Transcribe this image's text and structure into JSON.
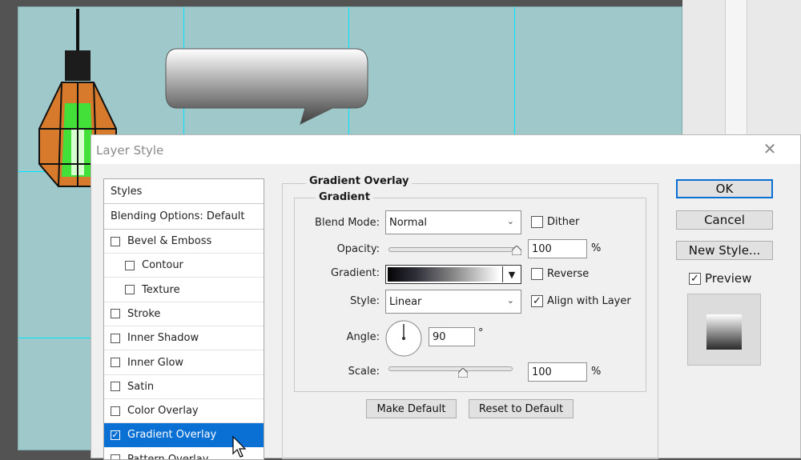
{
  "dialog": {
    "title": "Layer Style",
    "close_glyph": "✕"
  },
  "styles_list": {
    "header": "Styles",
    "blending": "Blending Options: Default",
    "items": [
      {
        "label": "Bevel & Emboss",
        "checked": false,
        "indent": false
      },
      {
        "label": "Contour",
        "checked": false,
        "indent": true
      },
      {
        "label": "Texture",
        "checked": false,
        "indent": true
      },
      {
        "label": "Stroke",
        "checked": false,
        "indent": false
      },
      {
        "label": "Inner Shadow",
        "checked": false,
        "indent": false
      },
      {
        "label": "Inner Glow",
        "checked": false,
        "indent": false
      },
      {
        "label": "Satin",
        "checked": false,
        "indent": false
      },
      {
        "label": "Color Overlay",
        "checked": false,
        "indent": false
      },
      {
        "label": "Gradient Overlay",
        "checked": true,
        "indent": false,
        "selected": true
      },
      {
        "label": "Pattern Overlay",
        "checked": false,
        "indent": false
      }
    ]
  },
  "panel": {
    "section_title": "Gradient Overlay",
    "group_title": "Gradient",
    "blend_mode_label": "Blend Mode:",
    "blend_mode_value": "Normal",
    "dither_label": "Dither",
    "dither_checked": false,
    "opacity_label": "Opacity:",
    "opacity_value": "100",
    "opacity_unit": "%",
    "opacity_fraction": 1.0,
    "gradient_label": "Gradient:",
    "reverse_label": "Reverse",
    "reverse_checked": false,
    "style_label": "Style:",
    "style_value": "Linear",
    "align_label": "Align with Layer",
    "align_checked": true,
    "angle_label": "Angle:",
    "angle_value": "90",
    "angle_unit": "°",
    "scale_label": "Scale:",
    "scale_value": "100",
    "scale_unit": "%",
    "scale_fraction": 0.6,
    "make_default": "Make Default",
    "reset_default": "Reset to Default"
  },
  "buttons": {
    "ok": "OK",
    "cancel": "Cancel",
    "new_style": "New Style...",
    "preview_label": "Preview",
    "preview_checked": true
  },
  "colors": {
    "canvas_bg": "#9fc8cb",
    "guide": "#00e5ff",
    "selection": "#0a70d3"
  }
}
